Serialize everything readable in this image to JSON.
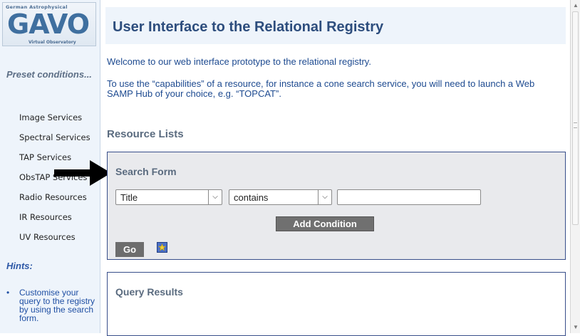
{
  "logo": {
    "top_text": "German Astrophysical",
    "main_text": "GAVO",
    "bottom_text": "Virtual Observatory"
  },
  "sidebar": {
    "preset_heading": "Preset conditions...",
    "items": [
      {
        "label": "Image Services"
      },
      {
        "label": "Spectral Services"
      },
      {
        "label": "TAP Services"
      },
      {
        "label": "ObsTAP Services"
      },
      {
        "label": "Radio Resources"
      },
      {
        "label": "IR Resources"
      },
      {
        "label": "UV Resources"
      }
    ],
    "hints_heading": "Hints:",
    "hint_text": "Customise your query to the registry by using the search form."
  },
  "main": {
    "title": "User Interface to the Relational Registry",
    "intro1": "Welcome to our web interface prototype to the relational registry.",
    "intro2": "To use the “capabilities” of a resource, for instance a cone search service, you will need to launch a Web SAMP Hub of your choice, e.g. “TOPCAT”.",
    "resource_lists": "Resource Lists",
    "search_form": {
      "title": "Search Form",
      "field_select": "Title",
      "operator_select": "contains",
      "value": "",
      "add_condition": "Add Condition",
      "go": "Go"
    },
    "query_results": "Query Results"
  },
  "colors": {
    "accent": "#2d4d7d",
    "sidebar_bg": "#eef4fb",
    "form_bg": "#e9eaed",
    "box_border": "#384e8a"
  },
  "icons": [
    "pointing-arrow-icon",
    "star-icon",
    "chevron-down-icon",
    "scroll-up-icon",
    "scroll-down-icon"
  ]
}
